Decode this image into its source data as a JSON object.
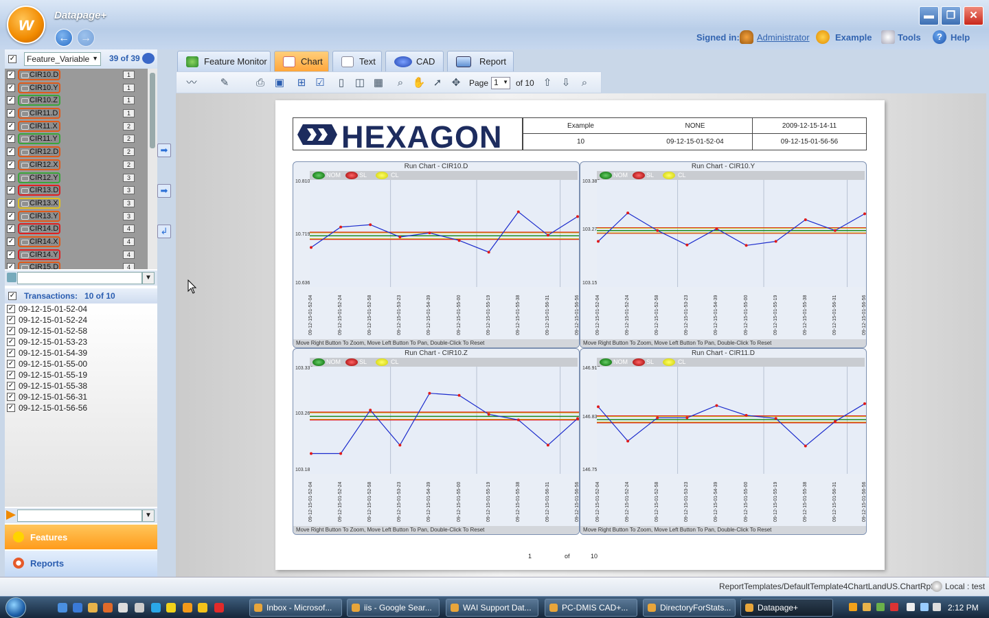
{
  "app": {
    "title": "Datapage+",
    "logo_letter": "w",
    "nav_back": "←",
    "nav_forward": "→"
  },
  "window_controls": {
    "minimize": "▬",
    "maximize": "❐",
    "close": "✕"
  },
  "header": {
    "signed_in_label": "Signed in:",
    "user": "Administrator",
    "example": "Example",
    "tools": "Tools",
    "help": "Help"
  },
  "features": {
    "selector_value": "Feature_Variable",
    "count": "39 of 39",
    "items": [
      {
        "label": "CIR10.D",
        "num": "1",
        "color": "#e05a1a"
      },
      {
        "label": "CIR10.Y",
        "num": "1",
        "color": "#e05a1a"
      },
      {
        "label": "CIR10.Z",
        "num": "1",
        "color": "#3aa63a"
      },
      {
        "label": "CIR11.D",
        "num": "1",
        "color": "#e05a1a"
      },
      {
        "label": "CIR11.X",
        "num": "2",
        "color": "#e05a1a"
      },
      {
        "label": "CIR11.Y",
        "num": "2",
        "color": "#3aa63a"
      },
      {
        "label": "CIR12.D",
        "num": "2",
        "color": "#e05a1a"
      },
      {
        "label": "CIR12.X",
        "num": "2",
        "color": "#e05a1a"
      },
      {
        "label": "CIR12.Y",
        "num": "3",
        "color": "#3aa63a"
      },
      {
        "label": "CIR13.D",
        "num": "3",
        "color": "#e02020"
      },
      {
        "label": "CIR13.X",
        "num": "3",
        "color": "#e0c020"
      },
      {
        "label": "CIR13.Y",
        "num": "3",
        "color": "#e05a1a"
      },
      {
        "label": "CIR14.D",
        "num": "4",
        "color": "#e02020"
      },
      {
        "label": "CIR14.X",
        "num": "4",
        "color": "#e05a1a"
      },
      {
        "label": "CIR14.Y",
        "num": "4",
        "color": "#e02020"
      },
      {
        "label": "CIR15.D",
        "num": "4",
        "color": "#e05a1a"
      }
    ]
  },
  "transactions": {
    "label": "Transactions:",
    "count": "10 of 10",
    "items": [
      "09-12-15-01-52-04",
      "09-12-15-01-52-24",
      "09-12-15-01-52-58",
      "09-12-15-01-53-23",
      "09-12-15-01-54-39",
      "09-12-15-01-55-00",
      "09-12-15-01-55-19",
      "09-12-15-01-55-38",
      "09-12-15-01-56-31",
      "09-12-15-01-56-56"
    ]
  },
  "panels": {
    "features": "Features",
    "reports": "Reports"
  },
  "tabs": [
    {
      "label": "Feature Monitor",
      "icon": "globe-icon"
    },
    {
      "label": "Chart",
      "icon": "chart-icon"
    },
    {
      "label": "Text",
      "icon": "text-icon"
    },
    {
      "label": "CAD",
      "icon": "cad-icon"
    },
    {
      "label": "Report",
      "icon": "report-icon"
    }
  ],
  "toolbar": {
    "page_label": "Page",
    "page_value": "1",
    "page_of": "of 10"
  },
  "report": {
    "logo_text": "HEXAGON",
    "header_cells": [
      "Example",
      "NONE",
      "2009-12-15-14-11",
      "10",
      "09-12-15-01-52-04",
      "09-12-15-01-56-56"
    ],
    "footer": {
      "page": "1",
      "of": "of",
      "total": "10"
    },
    "legend": {
      "nom": "NOM",
      "sl": "SL",
      "cl": "CL"
    },
    "hint": "Move Right Button To Zoom, Move Left Button To Pan, Double-Click To Reset"
  },
  "chart_data": [
    {
      "type": "line",
      "title": "Run Chart - CIR10.D",
      "x": [
        "09-12-15-01-52-04",
        "09-12-15-01-52-24",
        "09-12-15-01-52-58",
        "09-12-15-01-53-23",
        "09-12-15-01-54-39",
        "09-12-15-01-55-00",
        "09-12-15-01-55-19",
        "09-12-15-01-55-38",
        "09-12-15-01-56-31",
        "09-12-15-01-56-56"
      ],
      "y": [
        10.699,
        10.734,
        10.738,
        10.717,
        10.724,
        10.711,
        10.691,
        10.76,
        10.72,
        10.752
      ],
      "yticks": [
        "10.810",
        "10.719",
        "10.636"
      ],
      "ylim": [
        10.636,
        10.81
      ],
      "nom": 10.719,
      "sl": [
        10.713,
        10.725
      ],
      "cl": [
        10.714,
        10.724
      ]
    },
    {
      "type": "line",
      "title": "Run Chart - CIR10.Y",
      "x": [
        "09-12-15-01-52-04",
        "09-12-15-01-52-24",
        "09-12-15-01-52-58",
        "09-12-15-01-53-23",
        "09-12-15-01-54-39",
        "09-12-15-01-55-00",
        "09-12-15-01-55-19",
        "09-12-15-01-55-38",
        "09-12-15-01-56-31",
        "09-12-15-01-56-56"
      ],
      "y": [
        103.252,
        103.315,
        103.276,
        103.244,
        103.28,
        103.243,
        103.252,
        103.3,
        103.276,
        103.313
      ],
      "yticks": [
        "103.382",
        "103.276",
        "103.157"
      ],
      "ylim": [
        103.157,
        103.382
      ],
      "nom": 103.276,
      "sl": [
        103.27,
        103.282
      ],
      "cl": [
        103.271,
        103.281
      ]
    },
    {
      "type": "line",
      "title": "Run Chart - CIR10.Z",
      "x": [
        "09-12-15-01-52-04",
        "09-12-15-01-52-24",
        "09-12-15-01-52-58",
        "09-12-15-01-53-23",
        "09-12-15-01-54-39",
        "09-12-15-01-55-00",
        "09-12-15-01-55-19",
        "09-12-15-01-55-38",
        "09-12-15-01-56-31",
        "09-12-15-01-56-56"
      ],
      "y": [
        103.214,
        103.214,
        103.276,
        103.226,
        103.3,
        103.297,
        103.27,
        103.262,
        103.226,
        103.264
      ],
      "yticks": [
        "103.334",
        "103.269",
        "103.189"
      ],
      "ylim": [
        103.189,
        103.334
      ],
      "nom": 103.267,
      "sl": [
        103.262,
        103.273
      ],
      "cl": [
        103.263,
        103.272
      ]
    },
    {
      "type": "line",
      "title": "Run Chart - CIR11.D",
      "x": [
        "09-12-15-01-52-04",
        "09-12-15-01-52-24",
        "09-12-15-01-52-58",
        "09-12-15-01-53-23",
        "09-12-15-01-54-39",
        "09-12-15-01-55-00",
        "09-12-15-01-55-19",
        "09-12-15-01-55-38",
        "09-12-15-01-56-31",
        "09-12-15-01-56-56"
      ],
      "y": [
        146.856,
        146.8,
        146.838,
        146.838,
        146.858,
        146.842,
        146.837,
        146.792,
        146.832,
        146.861
      ],
      "yticks": [
        "146.917",
        "146.837",
        "146.751"
      ],
      "ylim": [
        146.751,
        146.917
      ],
      "nom": 146.835,
      "sl": [
        146.83,
        146.841
      ],
      "cl": [
        146.831,
        146.84
      ]
    }
  ],
  "status": {
    "path": "ReportTemplates/DefaultTemplate4ChartLandUS.ChartRpt",
    "local": "Local : test"
  },
  "taskbar": {
    "tasks": [
      "Inbox - Microsof...",
      "iis - Google Sear...",
      "WAI Support Dat...",
      "PC-DMIS CAD+...",
      "DirectoryForStats...",
      "Datapage+"
    ],
    "clock": "2:12 PM"
  }
}
